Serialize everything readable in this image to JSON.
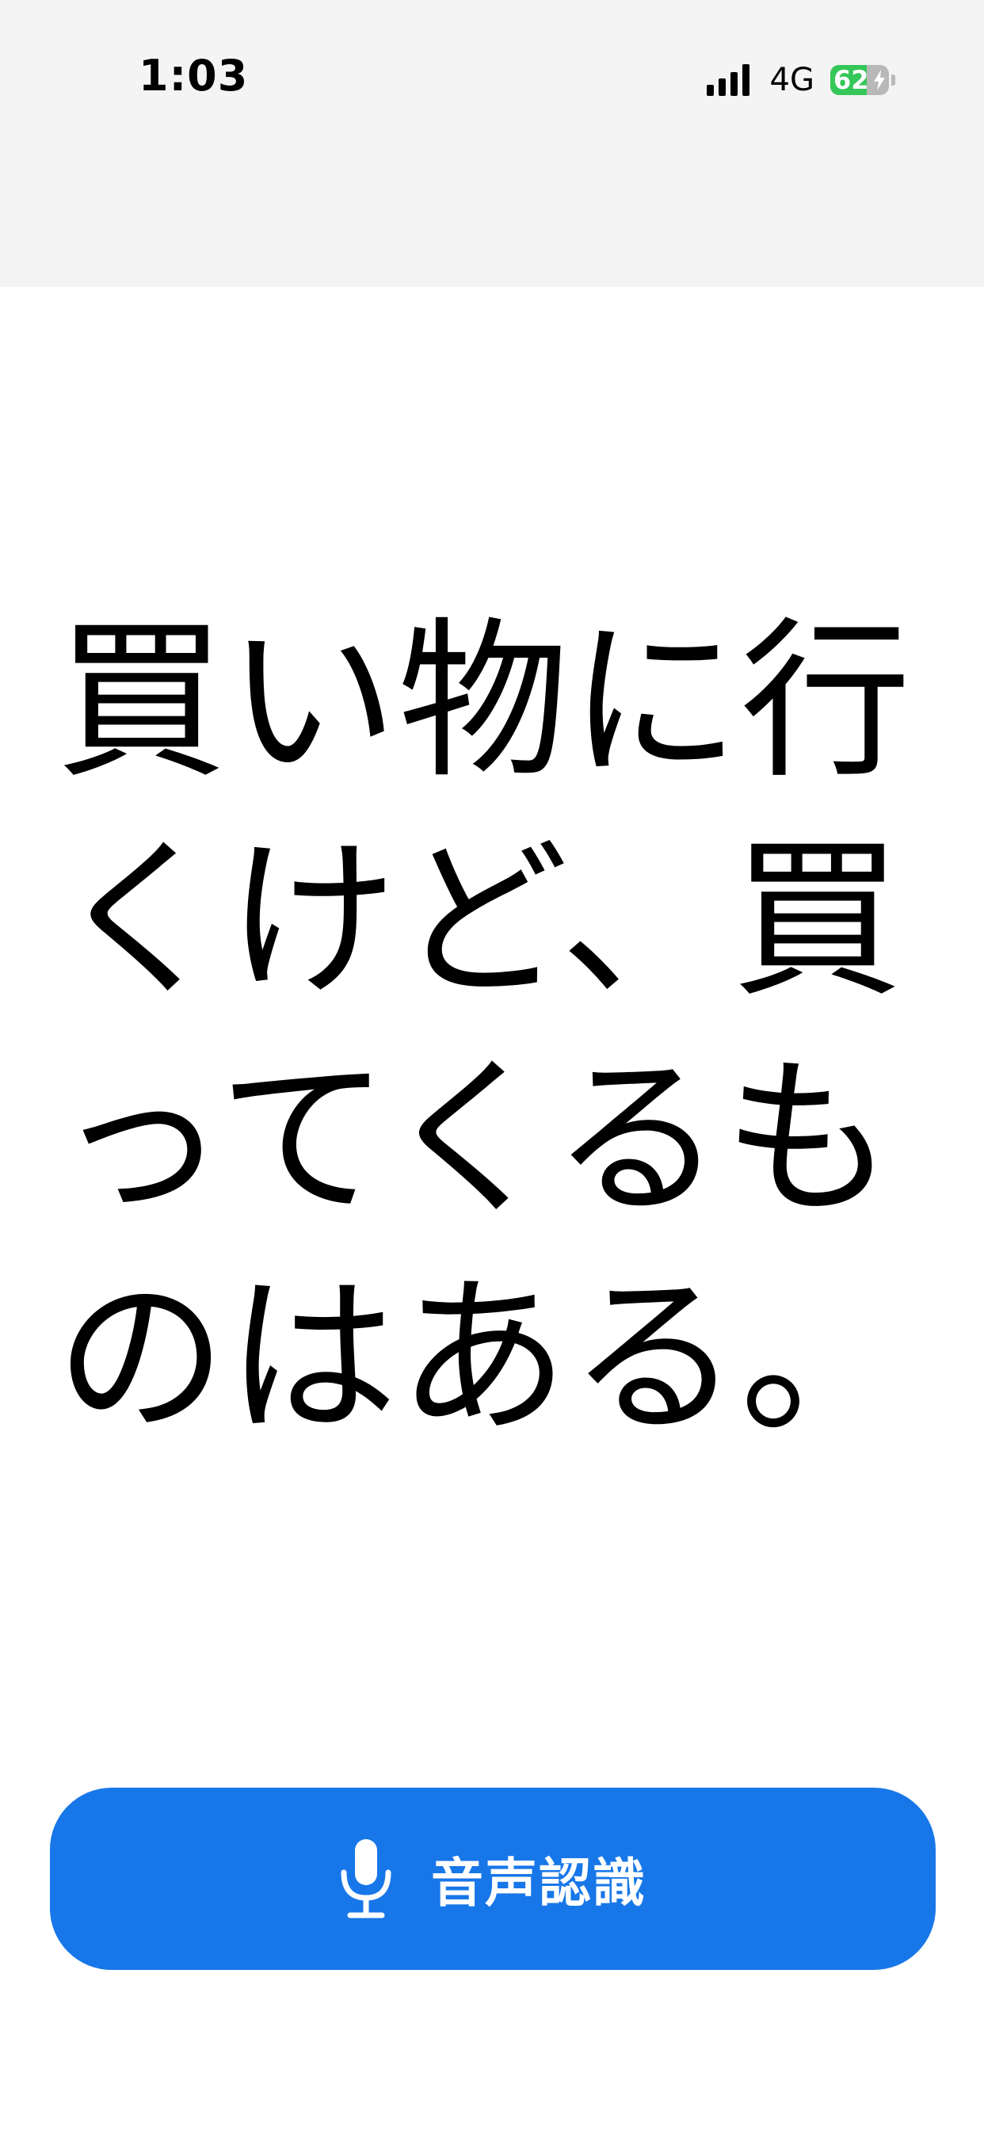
{
  "status_bar": {
    "time": "1:03",
    "network": "4G",
    "battery_percent": "62",
    "battery_level": 0.62,
    "signal_bars": 4
  },
  "main": {
    "text": "買い物に行くけど、買ってくるものはある。"
  },
  "speech_button": {
    "label": "音声認識",
    "icon": "microphone-icon",
    "color": "#1877e8"
  },
  "colors": {
    "header_bg": "#f4f4f4",
    "battery_green": "#35c759"
  }
}
